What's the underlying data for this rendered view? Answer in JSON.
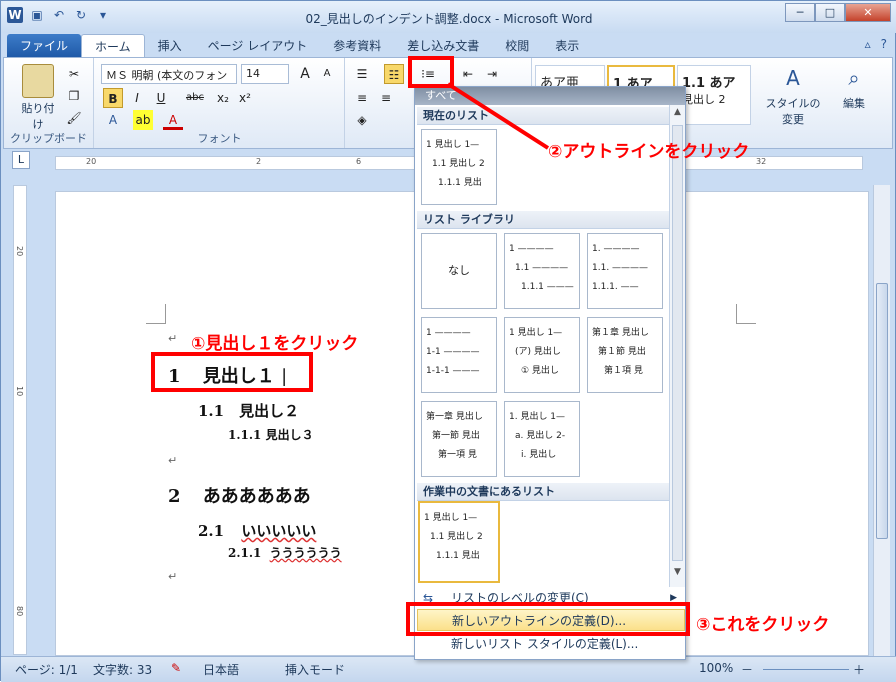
{
  "window": {
    "title": "02_見出しのインデント調整.docx - Microsoft Word",
    "logo": "W",
    "minimize": "─",
    "maximize": "□",
    "close": "✕"
  },
  "tabs": [
    "ファイル",
    "ホーム",
    "挿入",
    "ページ レイアウト",
    "参考資料",
    "差し込み文書",
    "校閲",
    "表示"
  ],
  "ribbon": {
    "clipboard": {
      "paste": "貼り付け",
      "label": "クリップボード"
    },
    "font": {
      "name": "ＭＳ 明朝 (本文のフォン",
      "size": "14",
      "label": "フォント",
      "bold": "B",
      "italic": "I",
      "underline": "U",
      "strike": "abc",
      "sub": "x₂",
      "sup": "x²",
      "grow": "A",
      "shrink": "A"
    },
    "styles": {
      "s1": "あア亜",
      "s2": "1 あア",
      "s3": "1.1 あア",
      "s3b": "見出し 2",
      "change": "スタイルの",
      "change2": "変更"
    },
    "edit": {
      "label": "編集"
    }
  },
  "document": {
    "h1a_num": "1",
    "h1a_text": "見出し１",
    "h2a": "1.1　見出し２",
    "h3a": "1.1.1 見出し３",
    "h1b_num": "2",
    "h1b_text": "ああああああ",
    "h2b_num": "2.1",
    "h2b_text": "いいいいい",
    "h3b_num": "2.1.1",
    "h3b_text": "うううううう"
  },
  "dropdown": {
    "top": "すべて",
    "current_section": "現在のリスト",
    "library_section": "リスト ライブラリ",
    "doc_section": "作業中の文書にあるリスト",
    "none": "なし",
    "current": [
      "1 見出し 1—",
      "1.1 見出し 2",
      "1.1.1 見出"
    ],
    "lib1": [
      "1 ————",
      "1.1 ————",
      "1.1.1 ———"
    ],
    "lib2": [
      "1. ————",
      "1.1. ————",
      "1.1.1. ——"
    ],
    "lib3": [
      "1 ————",
      "1-1 ————",
      "1-1-1 ———"
    ],
    "lib4": [
      "1 見出し 1—",
      "(ア) 見出し",
      "① 見出し"
    ],
    "lib5": [
      "第１章 見出し",
      "第１節 見出",
      "第１項 見"
    ],
    "lib6": [
      "第一章 見出し",
      "第一節 見出",
      "第一項 見"
    ],
    "lib7": [
      "1. 見出し 1—",
      "a. 見出し 2-",
      "i. 見出し"
    ],
    "docl": [
      "1 見出し 1—",
      "1.1 見出し 2",
      "1.1.1 見出"
    ],
    "change_level": "リストのレベルの変更(C)",
    "new_outline": "新しいアウトラインの定義(D)...",
    "new_style": "新しいリスト スタイルの定義(L)..."
  },
  "annotations": {
    "a1": "①見出し１をクリック",
    "a2": "②アウトラインをクリック",
    "a3": "③これをクリック"
  },
  "status": {
    "page": "ページ: 1/1",
    "words": "文字数: 33",
    "lang": "日本語",
    "mode": "挿入モード",
    "zoom": "100%",
    "minus": "－",
    "plus": "＋"
  }
}
